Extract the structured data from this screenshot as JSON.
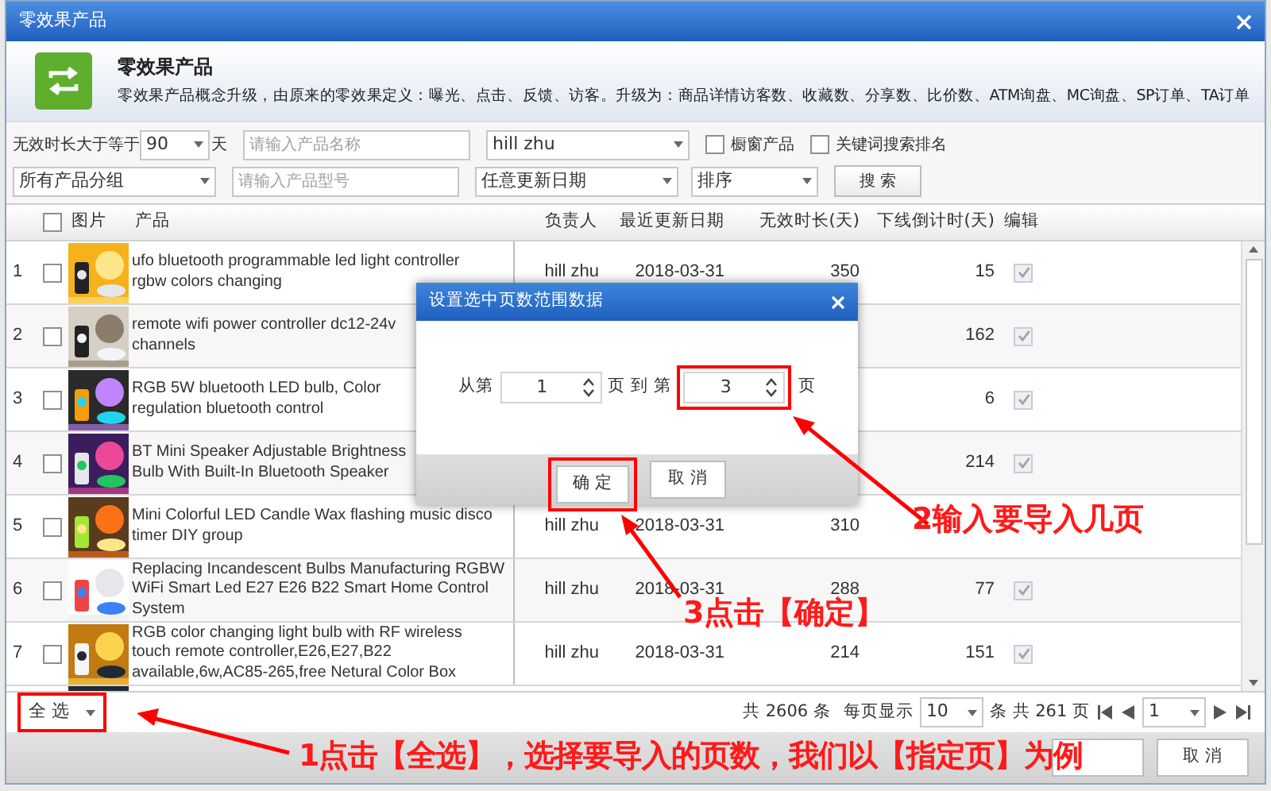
{
  "window": {
    "title": "零效果产品"
  },
  "header": {
    "title": "零效果产品",
    "description": "零效果产品概念升级，由原来的零效果定义：曝光、点击、反馈、访客。升级为：商品详情访客数、收藏数、分享数、比价数、ATM询盘、MC询盘、SP订单、TA订单"
  },
  "filters": {
    "min_days_label": "无效时长大于等于",
    "min_days": "90",
    "days_unit": "天",
    "name_placeholder": "请输入产品名称",
    "owner": "hill zhu",
    "checkboxes": [
      {
        "label": "橱窗产品",
        "checked": false
      },
      {
        "label": "关键词搜索排名",
        "checked": false
      }
    ],
    "group": "所有产品分组",
    "model_placeholder": "请输入产品型号",
    "date": "任意更新日期",
    "sort": "排序",
    "search_button": "搜 索"
  },
  "table": {
    "select_all_checked": false,
    "columns": [
      "图片",
      "产品",
      "负责人",
      "最近更新日期",
      "无效时长(天)",
      "下线倒计时(天)",
      "编辑"
    ],
    "rows": [
      {
        "index": "1",
        "checked": false,
        "product": "ufo bluetooth programmable led light controller\nrgbw colors changing",
        "owner": "hill zhu",
        "date": "2018-03-31",
        "idle": "350",
        "countdown": "15",
        "edit_checked": true
      },
      {
        "index": "2",
        "checked": false,
        "product": "remote wifi power controller dc12-24v\nchannels",
        "countdown": "162",
        "edit_checked": true
      },
      {
        "index": "3",
        "checked": false,
        "product": "RGB 5W bluetooth LED bulb, Color\nregulation bluetooth control",
        "countdown": "6",
        "edit_checked": true
      },
      {
        "index": "4",
        "checked": false,
        "product": "BT Mini Speaker Adjustable Brightness\nBulb With Built-In Bluetooth Speaker",
        "countdown": "214",
        "edit_checked": true
      },
      {
        "index": "5",
        "checked": false,
        "product": "Mini Colorful LED Candle Wax flashing music disco\ntimer DIY group",
        "owner": "hill zhu",
        "date": "2018-03-31",
        "idle": "310"
      },
      {
        "index": "6",
        "checked": false,
        "product": "Replacing Incandescent Bulbs Manufacturing RGBW\nWiFi Smart Led E27 E26 B22 Smart Home Control\nSystem",
        "owner": "hill zhu",
        "date": "2018-03-31",
        "idle": "288",
        "countdown": "77",
        "edit_checked": true
      },
      {
        "index": "7",
        "checked": false,
        "product": "RGB color changing light bulb with RF wireless\ntouch remote controller,E26,E27,B22\navailable,6w,AC85-265,free Netural Color Box",
        "owner": "hill zhu",
        "date": "2018-03-31",
        "idle": "214",
        "countdown": "151",
        "edit_checked": true
      }
    ]
  },
  "footer": {
    "select_menu": "全 选",
    "total": "共 2606 条",
    "per_page_label": "每页显示",
    "per_page": "10",
    "pages": "条 共 261 页",
    "page": "1",
    "cancel_button": "取 消"
  },
  "dialog": {
    "title": "设置选中页数范围数据",
    "from_label": "从第",
    "from": "1",
    "to_label": "页 到 第",
    "to": "3",
    "unit": "页",
    "ok_button": "确 定",
    "cancel_button": "取 消"
  },
  "annotations": [
    "2输入要导入几页",
    "3点击【确定】",
    "1点击【全选】，选择要导入的页数，我们以【指定页】为例"
  ]
}
